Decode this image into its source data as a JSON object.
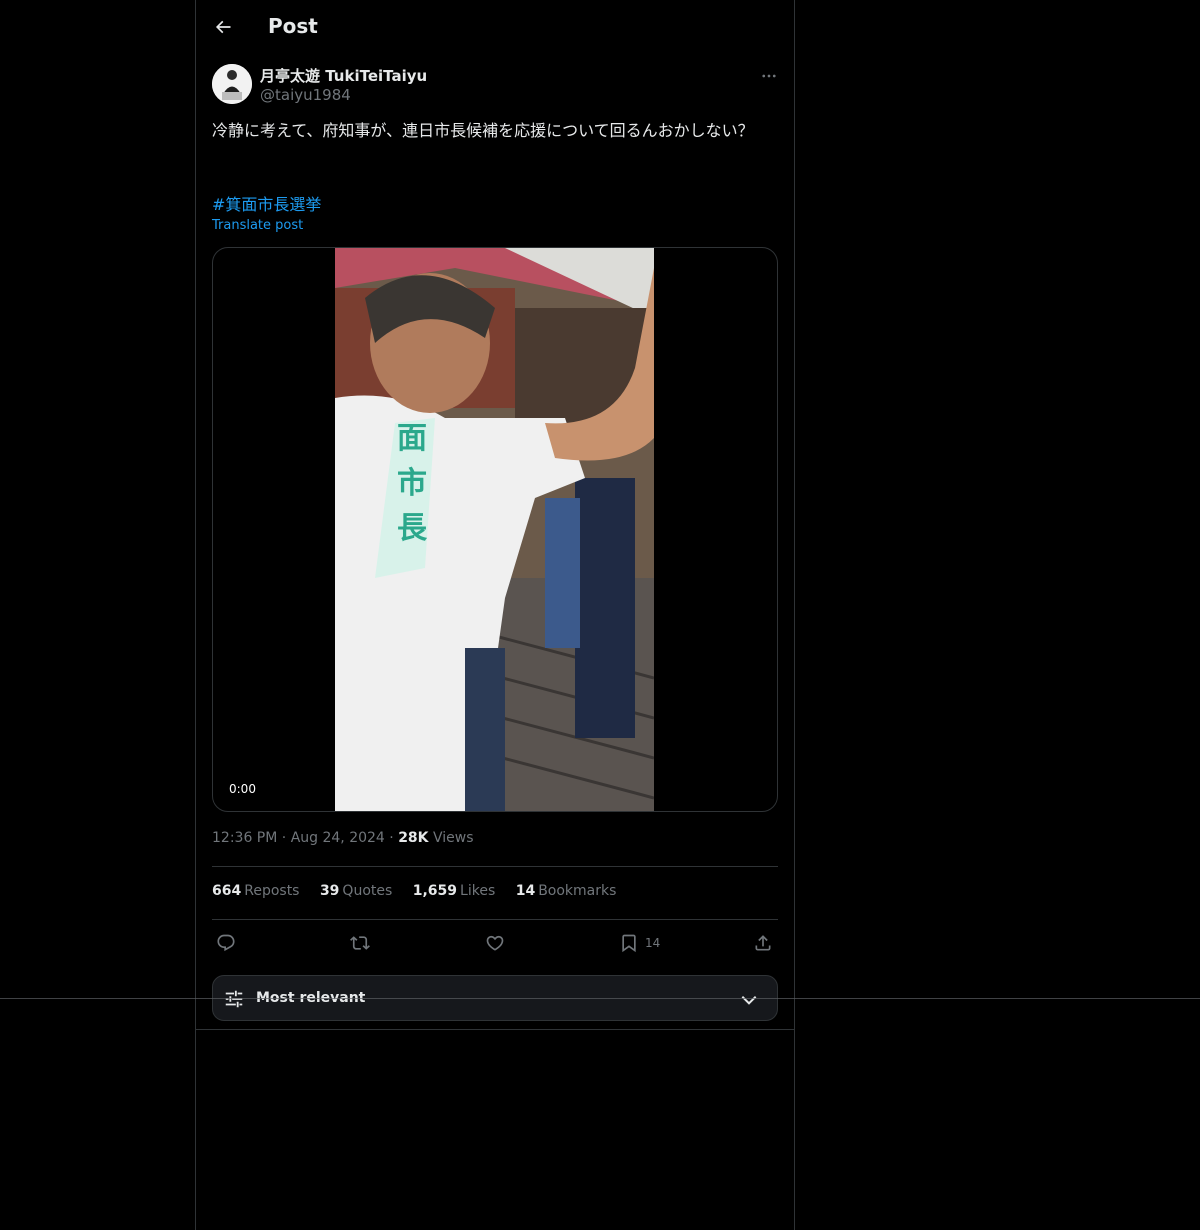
{
  "header": {
    "title": "Post"
  },
  "author": {
    "name": "月亭太遊 TukiTeiTaiyu",
    "handle": "@taiyu1984"
  },
  "post": {
    "text": "冷静に考えて、府知事が、連日市長候補を応援について回るんおかしない？",
    "hashtag": "#箕面市長選挙",
    "translate_label": "Translate post"
  },
  "media": {
    "time": "0:00"
  },
  "meta": {
    "time": "12:36 PM",
    "date": "Aug 24, 2024",
    "views_count": "28K",
    "views_label": "Views",
    "separator": "·"
  },
  "stats": {
    "reposts_count": "664",
    "reposts_label": "Reposts",
    "quotes_count": "39",
    "quotes_label": "Quotes",
    "likes_count": "1,659",
    "likes_label": "Likes",
    "bookmarks_count": "14",
    "bookmarks_label": "Bookmarks"
  },
  "actions": {
    "bookmark_count": "14"
  },
  "sort": {
    "label": "Most relevant"
  },
  "colors": {
    "accent": "#1d9bf0",
    "background": "#000000",
    "muted": "#71767b",
    "border": "#2f3336"
  },
  "icons": [
    "back-arrow-icon",
    "more-icon",
    "reply-icon",
    "repost-icon",
    "like-icon",
    "bookmark-icon",
    "share-icon",
    "sliders-icon",
    "chevron-down-icon"
  ]
}
